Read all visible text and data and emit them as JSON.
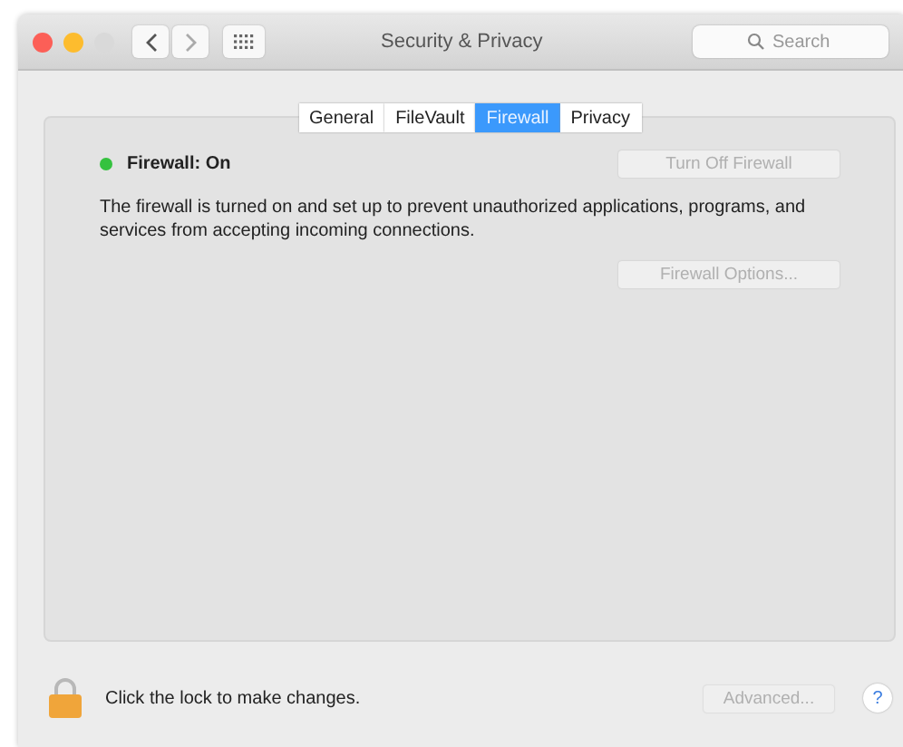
{
  "window": {
    "title": "Security & Privacy"
  },
  "search": {
    "placeholder": "Search"
  },
  "tabs": [
    {
      "label": "General",
      "selected": false
    },
    {
      "label": "FileVault",
      "selected": false
    },
    {
      "label": "Firewall",
      "selected": true
    },
    {
      "label": "Privacy",
      "selected": false
    }
  ],
  "firewall": {
    "status": "Firewall: On",
    "on": true,
    "toggle_button": {
      "label": "Turn Off Firewall",
      "disabled": true
    },
    "description": "The firewall is turned on and set up to prevent unauthorized applications, programs, and services from accepting incoming connections.",
    "options_button": {
      "label": "Firewall Options...",
      "disabled": true
    }
  },
  "footer": {
    "lock_text": "Click the lock to make changes.",
    "advanced_button": {
      "label": "Advanced...",
      "disabled": true
    },
    "help": "?"
  }
}
